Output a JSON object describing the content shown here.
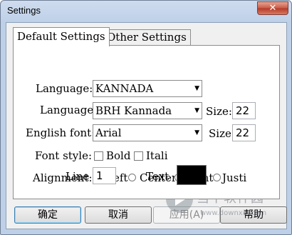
{
  "window": {
    "title": "Settings",
    "close_glyph": "✕"
  },
  "tabs": {
    "default": "Default Settings",
    "other": "Other Settings"
  },
  "form": {
    "language_label": "Language:",
    "language_value": "KANNADA",
    "font_label": "Language",
    "font_value": "BRH Kannada",
    "size_label": "Size:",
    "size_value": "22",
    "english_font_label": "English font:",
    "english_font_value": "Arial",
    "english_size_label": "Size:",
    "english_size_value": "22",
    "font_style_label": "Font style:",
    "bold_label": "Bold",
    "italic_label": "Itali",
    "alignment_label": "Alignment:",
    "align_left": "Left",
    "align_center": "Center",
    "align_right": "Right",
    "align_justify": "Justi",
    "line_label": "Line",
    "line_value": "1",
    "text_label": "Text",
    "text_color": "#000000"
  },
  "buttons": {
    "ok": "确定",
    "cancel": "取消",
    "apply": "应用(A)",
    "help": "帮助"
  },
  "watermark": {
    "text": "当下软件园",
    "url": "www.downxia.com"
  },
  "icons": {
    "dropdown_arrow": "▼"
  }
}
